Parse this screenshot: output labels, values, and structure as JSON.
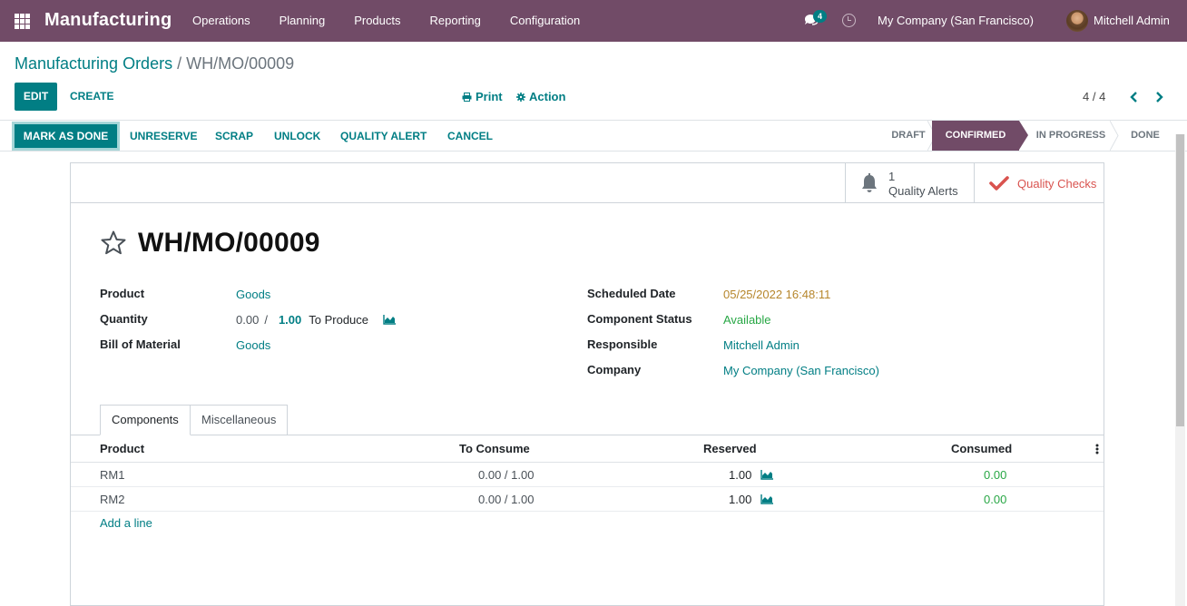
{
  "navbar": {
    "app_title": "Manufacturing",
    "menu": [
      "Operations",
      "Planning",
      "Products",
      "Reporting",
      "Configuration"
    ],
    "chat_badge": "4",
    "company": "My Company (San Francisco)",
    "user": "Mitchell Admin"
  },
  "breadcrumb": {
    "parent": "Manufacturing Orders",
    "separator": "/",
    "current": "WH/MO/00009"
  },
  "controls": {
    "edit": "EDIT",
    "create": "CREATE",
    "print": "Print",
    "action": "Action",
    "pager": "4 / 4"
  },
  "header_buttons": {
    "mark_as_done": "MARK AS DONE",
    "unreserve": "UNRESERVE",
    "scrap": "SCRAP",
    "unlock": "UNLOCK",
    "quality_alert": "QUALITY ALERT",
    "cancel": "CANCEL"
  },
  "stages": [
    "DRAFT",
    "CONFIRMED",
    "IN PROGRESS",
    "DONE"
  ],
  "active_stage": "CONFIRMED",
  "smart_buttons": {
    "quality_alerts_count": "1",
    "quality_alerts_label": "Quality Alerts",
    "quality_checks_label": "Quality Checks"
  },
  "record": {
    "title": "WH/MO/00009",
    "product_label": "Product",
    "product_value": "Goods",
    "quantity_label": "Quantity",
    "quantity_done": "0.00",
    "quantity_sep": "/",
    "quantity_total": "1.00",
    "to_produce": "To Produce",
    "bom_label": "Bill of Material",
    "bom_value": "Goods",
    "scheduled_label": "Scheduled Date",
    "scheduled_value": "05/25/2022 16:48:11",
    "component_status_label": "Component Status",
    "component_status_value": "Available",
    "responsible_label": "Responsible",
    "responsible_value": "Mitchell Admin",
    "company_label": "Company",
    "company_value": "My Company (San Francisco)"
  },
  "tabs": [
    "Components",
    "Miscellaneous"
  ],
  "table": {
    "columns": [
      "Product",
      "To Consume",
      "Reserved",
      "Consumed"
    ],
    "rows": [
      {
        "product": "RM1",
        "to_consume": "0.00 / 1.00",
        "reserved": "1.00",
        "consumed": "0.00"
      },
      {
        "product": "RM2",
        "to_consume": "0.00 / 1.00",
        "reserved": "1.00",
        "consumed": "0.00"
      }
    ],
    "add_line": "Add a line"
  },
  "colors": {
    "brand": "#714b67",
    "accent": "#017e84",
    "success": "#28a745",
    "warning": "#b6862c",
    "danger": "#d9534f"
  },
  "icons": [
    "apps-grid-icon",
    "chat-icon",
    "clock-icon",
    "print-icon",
    "gear-icon",
    "chevron-left-icon",
    "chevron-right-icon",
    "bell-icon",
    "check-icon",
    "star-icon",
    "graph-icon",
    "kebab-icon"
  ]
}
